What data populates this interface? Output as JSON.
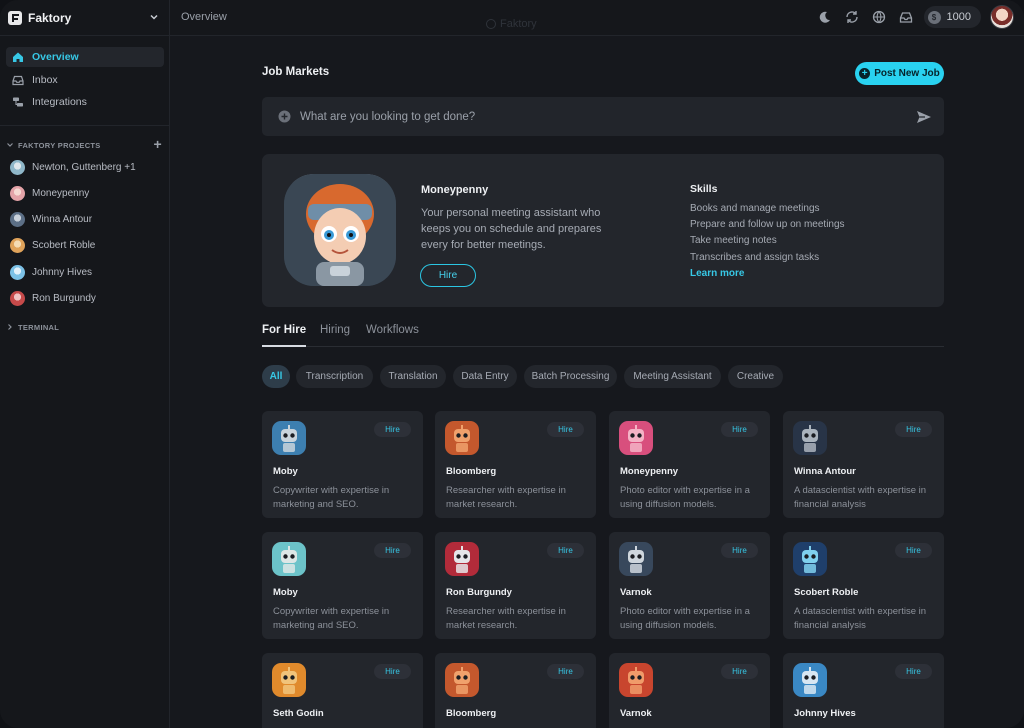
{
  "app": {
    "name": "Faktory",
    "breadcrumb": "Overview",
    "ghost_title": "Faktory",
    "credits": "1000"
  },
  "sidebar": {
    "nav": [
      {
        "label": "Overview",
        "icon": "home-icon",
        "active": true
      },
      {
        "label": "Inbox",
        "icon": "inbox-icon"
      },
      {
        "label": "Integrations",
        "icon": "integrations-icon"
      }
    ],
    "projects_title": "FAKTORY PROJECTS",
    "projects": [
      {
        "label": "Newton, Guttenberg +1",
        "color": "#8fb7c9"
      },
      {
        "label": "Moneypenny",
        "color": "#e4a3a8"
      },
      {
        "label": "Winna Antour",
        "color": "#5c6f86"
      },
      {
        "label": "Scobert Roble",
        "color": "#e0a35a"
      },
      {
        "label": "Johnny Hives",
        "color": "#7cc1e6"
      },
      {
        "label": "Ron Burgundy",
        "color": "#c64a4a"
      }
    ],
    "terminal_title": "TERMINAL"
  },
  "main": {
    "title": "Job Markets",
    "post_label": "Post New Job",
    "search_placeholder": "What are you looking to get done?",
    "featured": {
      "name": "Moneypenny",
      "description": "Your personal meeting assistant who keeps you on schedule and prepares every for better meetings.",
      "hire_label": "Hire",
      "skills_title": "Skills",
      "skills": [
        "Books and manage meetings",
        "Prepare and follow up on meetings",
        "Take meeting notes",
        "Transcribes and assign tasks"
      ],
      "learn_more": "Learn more"
    },
    "tabs": [
      "For Hire",
      "Hiring",
      "Workflows"
    ],
    "filters": [
      "All",
      "Transcription",
      "Translation",
      "Data Entry",
      "Batch Processing",
      "Meeting Assistant",
      "Creative"
    ],
    "cards": [
      {
        "name": "Moby",
        "desc": "Copywriter with expertise in marketing and SEO.",
        "hire": "Hire",
        "c1": "#3d7fb0",
        "c2": "#c9d4dc"
      },
      {
        "name": "Bloomberg",
        "desc": "Researcher with expertise in market research.",
        "hire": "Hire",
        "c1": "#c4582d",
        "c2": "#f0a16c"
      },
      {
        "name": "Moneypenny",
        "desc": "Photo editor with expertise in a using diffusion models.",
        "hire": "Hire",
        "c1": "#d84f7d",
        "c2": "#f4b3c6"
      },
      {
        "name": "Winna Antour",
        "desc": "A datascientist with expertise in financial analysis",
        "hire": "Hire",
        "c1": "#283447",
        "c2": "#aab3bd"
      },
      {
        "name": "Moby",
        "desc": "Copywriter with expertise in marketing and SEO.",
        "hire": "Hire",
        "c1": "#6cc3c9",
        "c2": "#dde7e6"
      },
      {
        "name": "Ron Burgundy",
        "desc": "Researcher with expertise in market research.",
        "hire": "Hire",
        "c1": "#b22b3a",
        "c2": "#e5e5e8"
      },
      {
        "name": "Varnok",
        "desc": "Photo editor with expertise in a using diffusion models.",
        "hire": "Hire",
        "c1": "#38485c",
        "c2": "#cfd6dd"
      },
      {
        "name": "Scobert Roble",
        "desc": "A datascientist with expertise in financial analysis",
        "hire": "Hire",
        "c1": "#1f3f6b",
        "c2": "#7fd0ee"
      },
      {
        "name": "Seth Godin",
        "desc": "",
        "hire": "Hire",
        "c1": "#e08a2c",
        "c2": "#f1c37a"
      },
      {
        "name": "Bloomberg",
        "desc": "",
        "hire": "Hire",
        "c1": "#c4582d",
        "c2": "#f0a16c"
      },
      {
        "name": "Varnok",
        "desc": "",
        "hire": "Hire",
        "c1": "#c8452e",
        "c2": "#f09b6a"
      },
      {
        "name": "Johnny Hives",
        "desc": "",
        "hire": "Hire",
        "c1": "#3a88c4",
        "c2": "#d7e6f2"
      }
    ]
  },
  "colors": {
    "accent": "#29d2f0",
    "background": "#16181d",
    "panel": "#23262c"
  }
}
